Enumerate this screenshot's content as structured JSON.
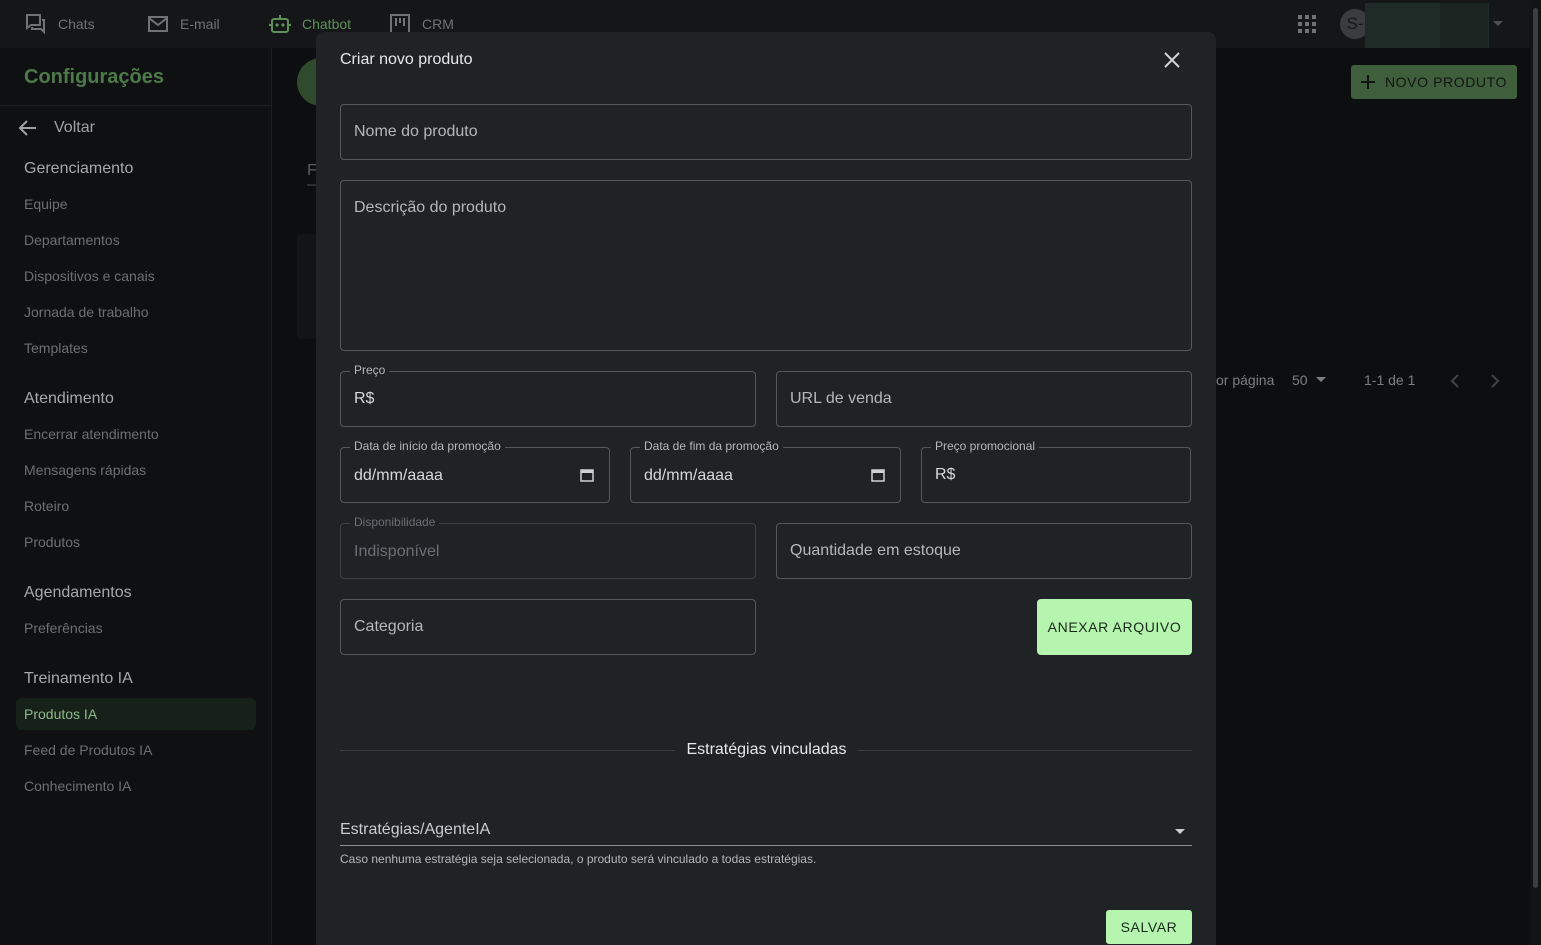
{
  "topnav": {
    "items": [
      {
        "label": "Chats",
        "icon": "chat-icon"
      },
      {
        "label": "E-mail",
        "icon": "mail-icon"
      },
      {
        "label": "Chatbot",
        "icon": "robot-icon",
        "active": true
      },
      {
        "label": "CRM",
        "icon": "kanban-icon"
      }
    ],
    "avatar_initial": "S-"
  },
  "sidebar": {
    "title": "Configurações",
    "back_label": "Voltar",
    "sections": [
      {
        "title": "Gerenciamento",
        "items": [
          "Equipe",
          "Departamentos",
          "Dispositivos e canais",
          "Jornada de trabalho",
          "Templates"
        ]
      },
      {
        "title": "Atendimento",
        "items": [
          "Encerrar atendimento",
          "Mensagens rápidas",
          "Roteiro",
          "Produtos"
        ]
      },
      {
        "title": "Agendamentos",
        "items": [
          "Preferências"
        ]
      },
      {
        "title": "Treinamento IA",
        "items": [
          "Produtos IA",
          "Feed de Produtos IA",
          "Conhecimento IA"
        ]
      }
    ],
    "active_item": "Produtos IA"
  },
  "main": {
    "new_product_button": "NOVO PRODUTO",
    "tab_partial": "F",
    "pagination": {
      "per_page_label": "or página",
      "per_page_value": "50",
      "range": "1-1 de 1"
    }
  },
  "modal": {
    "title": "Criar novo produto",
    "fields": {
      "name_placeholder": "Nome do produto",
      "description_placeholder": "Descrição do produto",
      "price_label": "Preço",
      "price_prefix": "R$",
      "url_placeholder": "URL de venda",
      "promo_start_label": "Data de início da promoção",
      "promo_start_value": "dd/mm/aaaa",
      "promo_end_label": "Data de fim da promoção",
      "promo_end_value": "dd/mm/aaaa",
      "promo_price_label": "Preço promocional",
      "promo_price_prefix": "R$",
      "availability_label": "Disponibilidade",
      "availability_value": "Indisponível",
      "stock_placeholder": "Quantidade em estoque",
      "category_placeholder": "Categoria"
    },
    "attach_button": "ANEXAR ARQUIVO",
    "strategies_title": "Estratégias vinculadas",
    "strategies_select_label": "Estratégias/AgenteIA",
    "strategies_helper": "Caso nenhuma estratégia seja selecionada, o produto será vinculado a todas estratégias.",
    "save_button": "SALVAR"
  },
  "colors": {
    "accent": "#4c7a48",
    "button_light": "#b5f5b0",
    "modal_bg": "#202325"
  }
}
